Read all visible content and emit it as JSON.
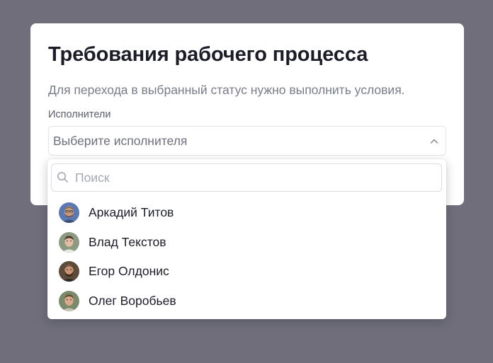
{
  "modal": {
    "title": "Требования рабочего процесса",
    "description": "Для перехода в выбранный статус нужно выполнить условия.",
    "field_label": "Исполнители",
    "select_placeholder": "Выберите исполнителя",
    "select_icon": "chevron-up-icon"
  },
  "dropdown": {
    "search_placeholder": "Поиск",
    "search_icon": "search-icon",
    "options": [
      {
        "name": "Аркадий Титов",
        "avatar_bg": "#5a79b3"
      },
      {
        "name": "Влад Текстов",
        "avatar_bg": "#8d9a82"
      },
      {
        "name": "Егор Олдонис",
        "avatar_bg": "#5c4a3a"
      },
      {
        "name": "Олег Воробьев",
        "avatar_bg": "#7c8a6c"
      }
    ]
  },
  "colors": {
    "backdrop": "#6f6e7a",
    "text_primary": "#1b1c28",
    "text_secondary": "#7a7c89"
  }
}
